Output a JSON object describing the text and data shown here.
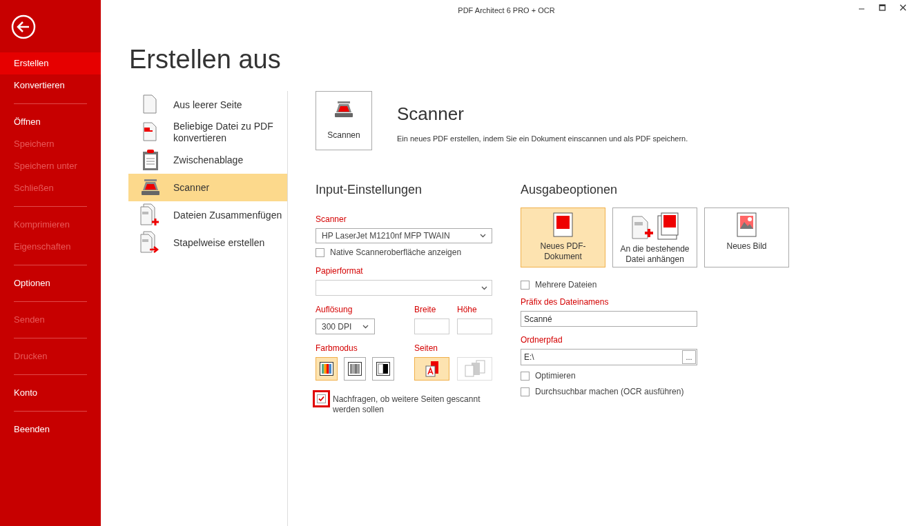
{
  "window": {
    "title": "PDF Architect 6 PRO + OCR"
  },
  "sidebar": {
    "groups": [
      {
        "items": [
          {
            "label": "Erstellen",
            "selected": true,
            "disabled": false
          },
          {
            "label": "Konvertieren",
            "selected": false,
            "disabled": false
          }
        ]
      },
      {
        "items": [
          {
            "label": "Öffnen",
            "selected": false,
            "disabled": false
          },
          {
            "label": "Speichern",
            "selected": false,
            "disabled": true
          },
          {
            "label": "Speichern unter",
            "selected": false,
            "disabled": true
          },
          {
            "label": "Schließen",
            "selected": false,
            "disabled": true
          }
        ]
      },
      {
        "items": [
          {
            "label": "Komprimieren",
            "selected": false,
            "disabled": true
          },
          {
            "label": "Eigenschaften",
            "selected": false,
            "disabled": true
          }
        ]
      },
      {
        "items": [
          {
            "label": "Optionen",
            "selected": false,
            "disabled": false
          }
        ]
      },
      {
        "items": [
          {
            "label": "Senden",
            "selected": false,
            "disabled": true
          }
        ]
      },
      {
        "items": [
          {
            "label": "Drucken",
            "selected": false,
            "disabled": true
          }
        ]
      },
      {
        "items": [
          {
            "label": "Konto",
            "selected": false,
            "disabled": false
          }
        ]
      },
      {
        "items": [
          {
            "label": "Beenden",
            "selected": false,
            "disabled": false
          }
        ]
      }
    ]
  },
  "page_title": "Erstellen aus",
  "sources": [
    {
      "kind": "blank",
      "label": "Aus leerer Seite",
      "selected": false
    },
    {
      "kind": "convert",
      "label": "Beliebige Datei zu PDF konvertieren",
      "selected": false
    },
    {
      "kind": "clipboard",
      "label": "Zwischenablage",
      "selected": false
    },
    {
      "kind": "scanner",
      "label": "Scanner",
      "selected": true
    },
    {
      "kind": "merge",
      "label": "Dateien Zusammenfügen",
      "selected": false
    },
    {
      "kind": "batch",
      "label": "Stapelweise erstellen",
      "selected": false
    }
  ],
  "action": {
    "button": "Scannen",
    "title": "Scanner",
    "description": "Ein neues PDF erstellen, indem Sie ein Dokument einscannen und als PDF speichern."
  },
  "input": {
    "heading": "Input-Einstellungen",
    "scanner_label": "Scanner",
    "scanner_value": "HP LaserJet M1210nf MFP TWAIN",
    "native_ui": {
      "label": "Native Scanneroberfläche anzeigen",
      "checked": false
    },
    "paper_label": "Papierformat",
    "resolution_label": "Auflösung",
    "resolution_value": "300 DPI",
    "width_label": "Breite",
    "height_label": "Höhe",
    "color_label": "Farbmodus",
    "color_modes": [
      {
        "kind": "color",
        "selected": true
      },
      {
        "kind": "gray",
        "selected": false
      },
      {
        "kind": "bw",
        "selected": false
      }
    ],
    "pages_label": "Seiten",
    "page_modes": [
      {
        "kind": "single",
        "selected": true
      },
      {
        "kind": "multi",
        "selected": false
      }
    ],
    "ask_more": {
      "label": "Nachfragen, ob weitere Seiten gescannt werden sollen",
      "checked": true,
      "highlighted": true
    }
  },
  "output": {
    "heading": "Ausgabeoptionen",
    "targets": [
      {
        "kind": "new_pdf",
        "label": "Neues PDF-Dokument",
        "selected": true
      },
      {
        "kind": "append",
        "label": "An die bestehende Datei anhängen",
        "selected": false
      },
      {
        "kind": "image",
        "label": "Neues Bild",
        "selected": false
      }
    ],
    "multiple": {
      "label": "Mehrere Dateien",
      "checked": false
    },
    "prefix_label": "Präfix des Dateinamens",
    "prefix_value": "Scanné",
    "folder_label": "Ordnerpfad",
    "folder_value": "E:\\",
    "browse": "...",
    "optimize": {
      "label": "Optimieren",
      "checked": false
    },
    "ocr": {
      "label": "Durchsuchbar machen (OCR ausführen)",
      "checked": false
    }
  }
}
